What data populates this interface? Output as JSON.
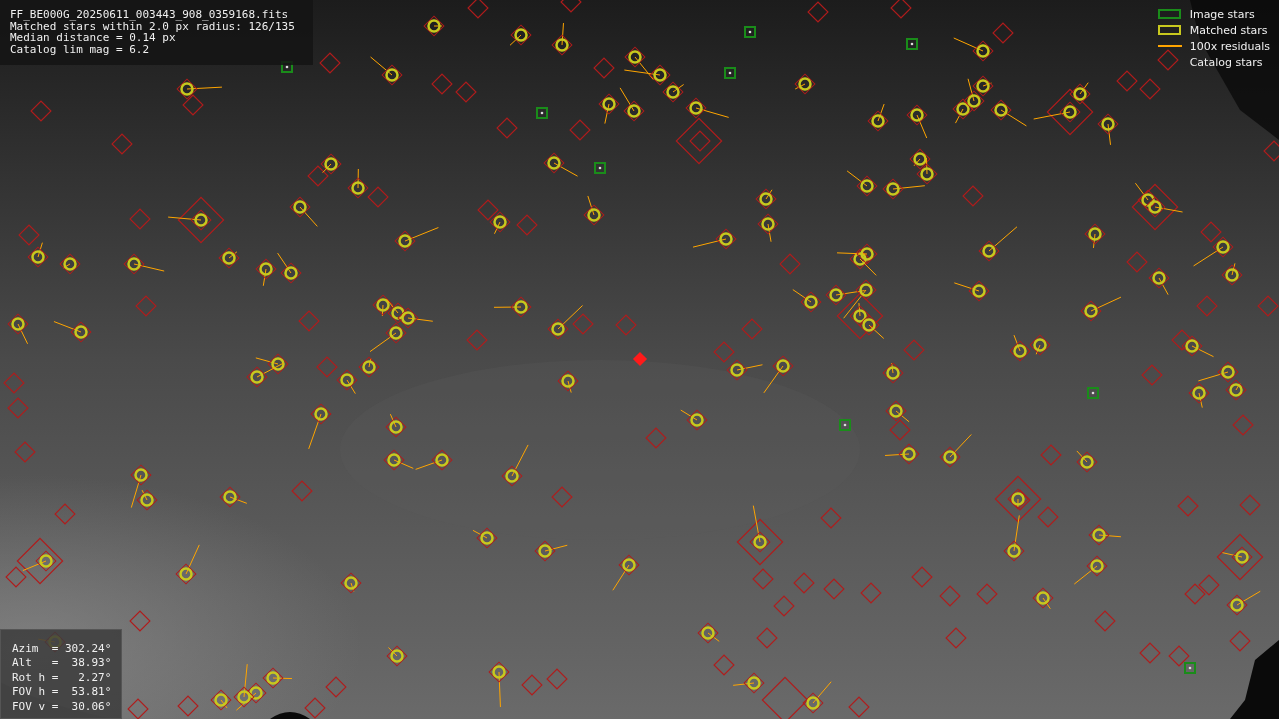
{
  "info_box": {
    "lines": [
      "FF_BE000G_20250611_003443_908_0359168.fits",
      "Matched stars within 2.0 px radius: 126/135",
      "Median distance = 0.14 px",
      "Catalog lim mag = 6.2"
    ]
  },
  "legend": [
    {
      "kind": "box",
      "color": "#1a8c1a",
      "label": "Image stars"
    },
    {
      "kind": "box",
      "color": "#c8c81e",
      "label": "Matched stars"
    },
    {
      "kind": "line",
      "color": "#ffa500",
      "label": "100x residuals"
    },
    {
      "kind": "none",
      "label": "Catalog stars"
    }
  ],
  "pointing_box": {
    "lines": [
      "Azim  = 302.24°",
      "Alt   =  38.93°",
      "Rot h =   2.27°",
      "FOV h =  53.81°",
      "FOV v =  30.06°"
    ]
  }
}
